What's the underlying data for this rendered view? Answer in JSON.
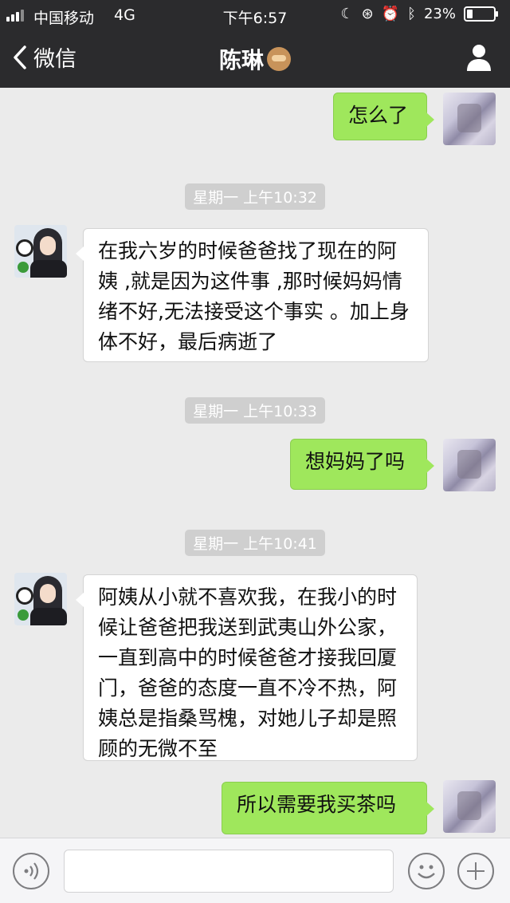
{
  "status_bar": {
    "carrier": "中国移动",
    "network": "4G",
    "time": "下午6:57",
    "battery": "23%",
    "battery_level": 0.23
  },
  "nav": {
    "back_label": "微信",
    "contact_name": "陈琳"
  },
  "messages": [
    {
      "from": "me",
      "text": "怎么了"
    },
    {
      "time": "星期一 上午10:32"
    },
    {
      "from": "her",
      "text": "在我六岁的时候爸爸找了现在的阿姨 ,就是因为这件事 ,那时候妈妈情绪不好,无法接受这个事实 。加上身体不好，最后病逝了"
    },
    {
      "time": "星期一 上午10:33"
    },
    {
      "from": "me",
      "text": "想妈妈了吗"
    },
    {
      "time": "星期一 上午10:41"
    },
    {
      "from": "her",
      "text": "阿姨从小就不喜欢我，在我小的时候让爸爸把我送到武夷山外公家，一直到高中的时候爸爸才接我回厦门，爸爸的态度一直不冷不热，阿姨总是指桑骂槐，对她儿子却是照顾的无微不至"
    },
    {
      "from": "me",
      "text": "所以需要我买茶吗"
    }
  ],
  "input": {
    "value": "",
    "placeholder": ""
  }
}
